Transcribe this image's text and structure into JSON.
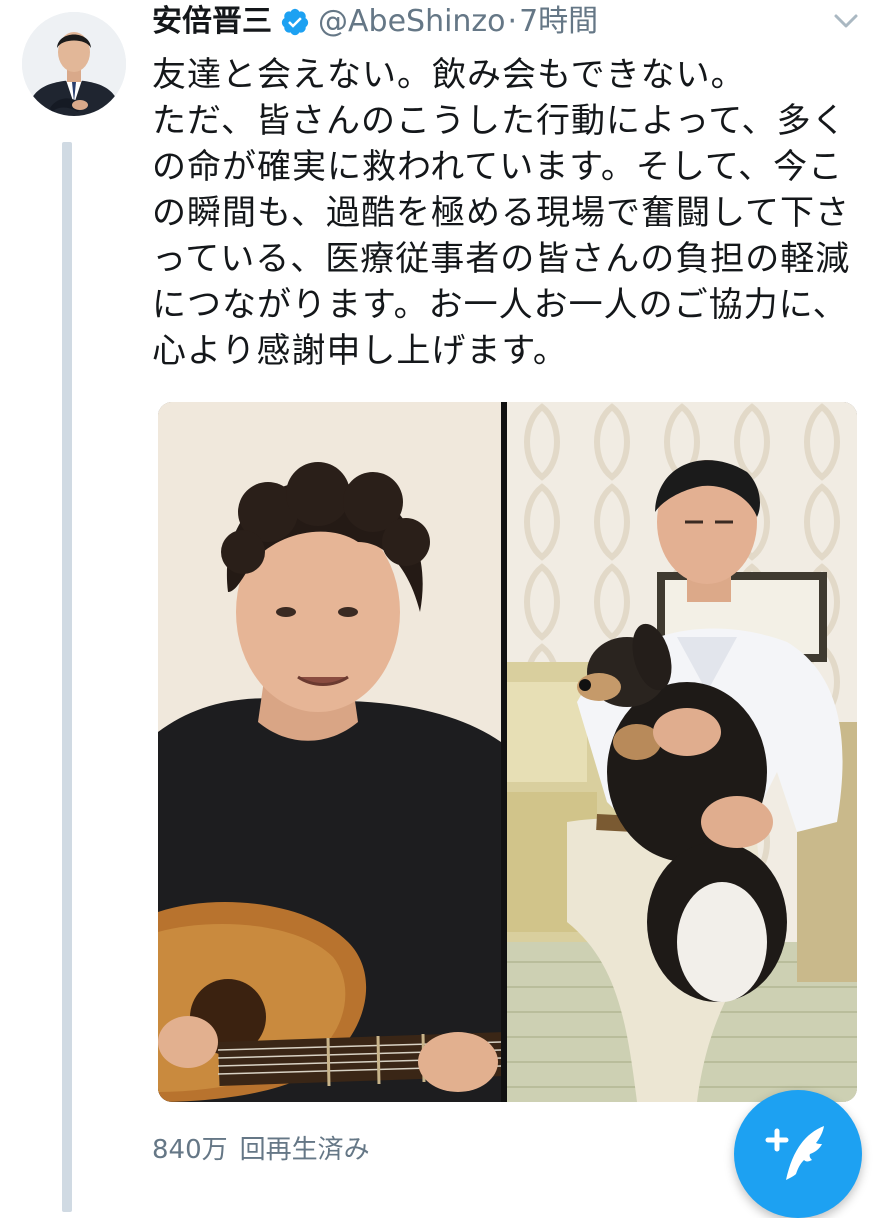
{
  "tweet": {
    "display_name": "安倍晋三",
    "handle": "@AbeShinzo",
    "separator": "·",
    "time": "7時間",
    "lines": [
      "友達と会えない。飲み会もできない。",
      "ただ、皆さんのこうした行動によって、多く",
      "の命が確実に救われています。そして、今こ",
      "の瞬間も、過酷を極める現場で奮闘して下さ",
      "っている、医療従事者の皆さんの負担の軽減",
      "につながります。お一人お一人のご協力に、",
      "心より感謝申し上げます。"
    ]
  },
  "media": {
    "view_count": "840万",
    "view_label": "回再生済み"
  },
  "colors": {
    "accent": "#1da1f2",
    "secondary_text": "#657786",
    "thread_line": "#d0dae3"
  },
  "icons": {
    "verified": "verified-badge-icon",
    "caret": "chevron-down-icon",
    "compose": "compose-tweet-icon"
  }
}
